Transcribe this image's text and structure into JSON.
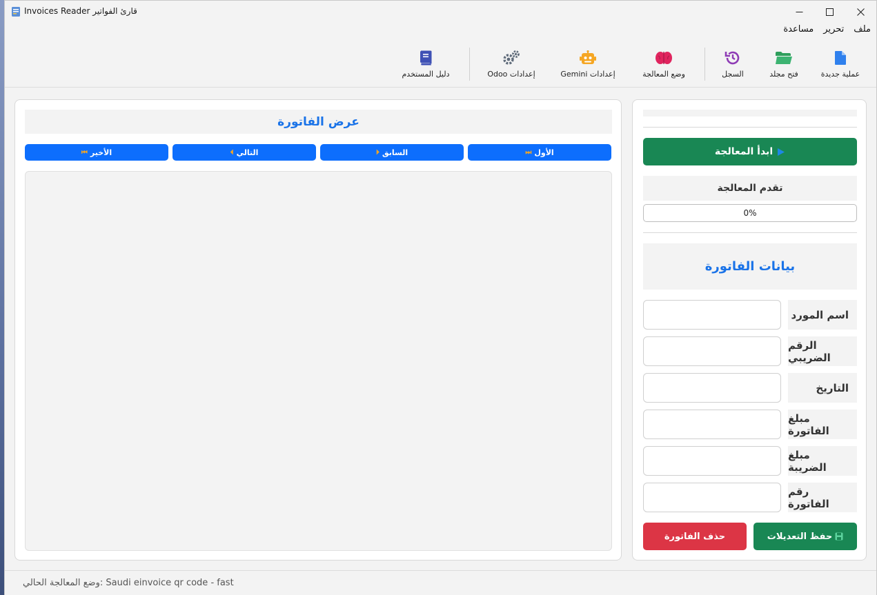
{
  "window": {
    "title": "Invoices Reader قارئ الفواتير"
  },
  "menu": [
    "ملف",
    "تحرير",
    "مساعدة"
  ],
  "toolbar": {
    "new_op": "عملية جديدة",
    "open_folder": "فتح مجلد",
    "history": "السجل",
    "processing_mode": "وضع المعالجة",
    "gemini_settings": "Gemini إعدادات",
    "odoo_settings": "Odoo إعدادات",
    "user_guide": "دليل المستخدم"
  },
  "viewer": {
    "title": "عرض الفاتورة",
    "first": "الأول",
    "previous": "السابق",
    "next": "التالي",
    "last": "الأخير"
  },
  "controls": {
    "start": "ابدأ المعالجة",
    "progress_label": "تقدم المعالجة",
    "progress_text": "0%",
    "progress_value": 0
  },
  "invoice": {
    "title": "بيانات الفاتورة",
    "fields": [
      {
        "label": "اسم المورد",
        "value": ""
      },
      {
        "label": "الرقم الضريبي",
        "value": ""
      },
      {
        "label": "التاريخ",
        "value": ""
      },
      {
        "label": "مبلغ الفاتورة",
        "value": ""
      },
      {
        "label": "مبلغ الضريبة",
        "value": ""
      },
      {
        "label": "رقم الفاتورة",
        "value": ""
      }
    ],
    "save": "حفظ التعديلات",
    "delete": "حذف الفاتورة"
  },
  "status": {
    "text": "وضع المعالجة الحالي: Saudi einvoice qr code - fast"
  },
  "colors": {
    "primary": "#0d6efd",
    "success": "#198754",
    "danger": "#dc3545",
    "title_blue": "#1a73e8"
  }
}
